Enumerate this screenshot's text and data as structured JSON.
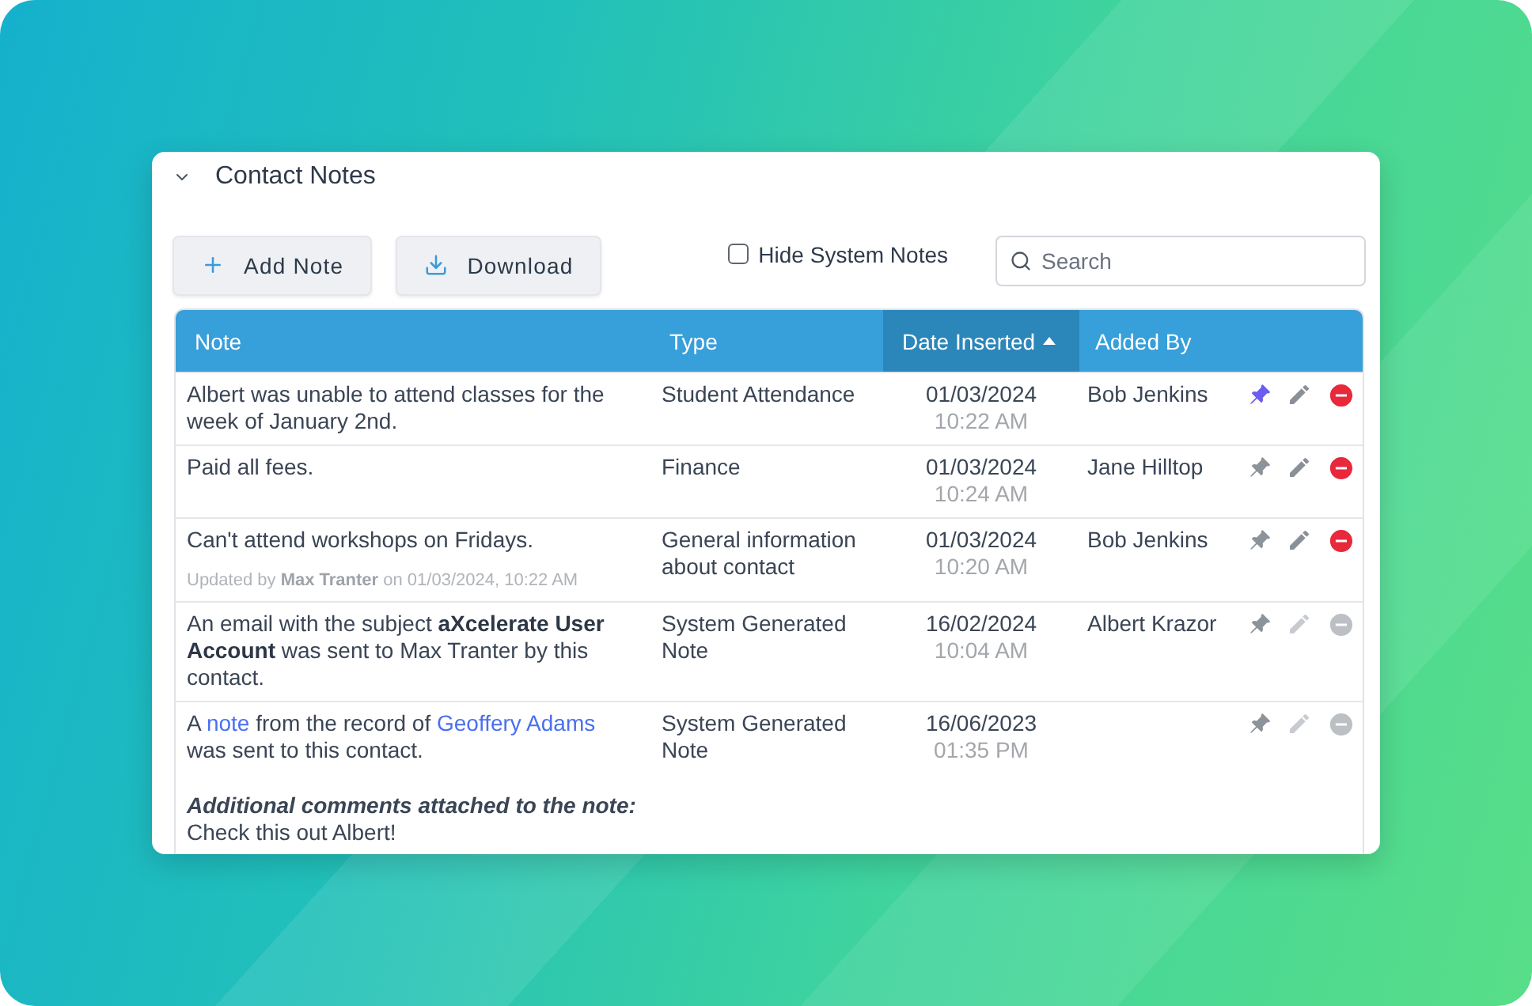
{
  "panel": {
    "title": "Contact Notes",
    "expanded": true
  },
  "toolbar": {
    "buttons": [
      {
        "kind": "add",
        "label": "Add Note"
      },
      {
        "kind": "download",
        "label": "Download"
      }
    ],
    "hide_system_notes": {
      "label": "Hide System Notes",
      "checked": false
    },
    "search": {
      "placeholder": "Search"
    }
  },
  "table": {
    "columns": [
      {
        "label": "Note",
        "sorted": false
      },
      {
        "label": "Type",
        "sorted": false
      },
      {
        "label": "Date Inserted",
        "sorted": true
      },
      {
        "label": "Added By",
        "sorted": false
      }
    ],
    "rows": [
      {
        "note": "Albert was unable to attend classes for the week of January 2nd.",
        "type": "Student Attendance",
        "date": "01/03/2024",
        "time": "10:22 AM",
        "added_by": "Bob Jenkins",
        "pinned": true,
        "editable": true,
        "deletable": true
      },
      {
        "note": "Paid all fees.",
        "type": "Finance",
        "date": "01/03/2024",
        "time": "10:24 AM",
        "added_by": "Jane Hilltop",
        "pinned": false,
        "editable": true,
        "deletable": true
      },
      {
        "note": "Can't attend workshops on Fridays.",
        "updated": "Updated by **Max Tranter** on 01/03/2024, 10:22 AM",
        "type": "General information about contact",
        "date": "01/03/2024",
        "time": "10:20 AM",
        "added_by": "Bob Jenkins",
        "pinned": false,
        "editable": true,
        "deletable": true
      },
      {
        "note": "An email with the subject **aXcelerate User Account** was sent to Max Tranter by this contact.",
        "type": "System Generated Note",
        "date": "16/02/2024",
        "time": "10:04 AM",
        "added_by": "Albert Krazor",
        "pinned": false,
        "editable": false,
        "deletable": false
      },
      {
        "note_parts": [
          {
            "kind": "text",
            "text": "A "
          },
          {
            "kind": "link",
            "text": "note"
          },
          {
            "kind": "text",
            "text": " from the record of "
          },
          {
            "kind": "link",
            "text": "Geoffery Adams"
          },
          {
            "kind": "text",
            "text": " was sent to this contact."
          }
        ],
        "comment": {
          "heading": "Additional comments attached to the note:",
          "text": "Check this out Albert!"
        },
        "type": "System Generated Note",
        "date": "16/06/2023",
        "time": "01:35 PM",
        "pinned": false,
        "editable": false,
        "deletable": false
      }
    ]
  }
}
